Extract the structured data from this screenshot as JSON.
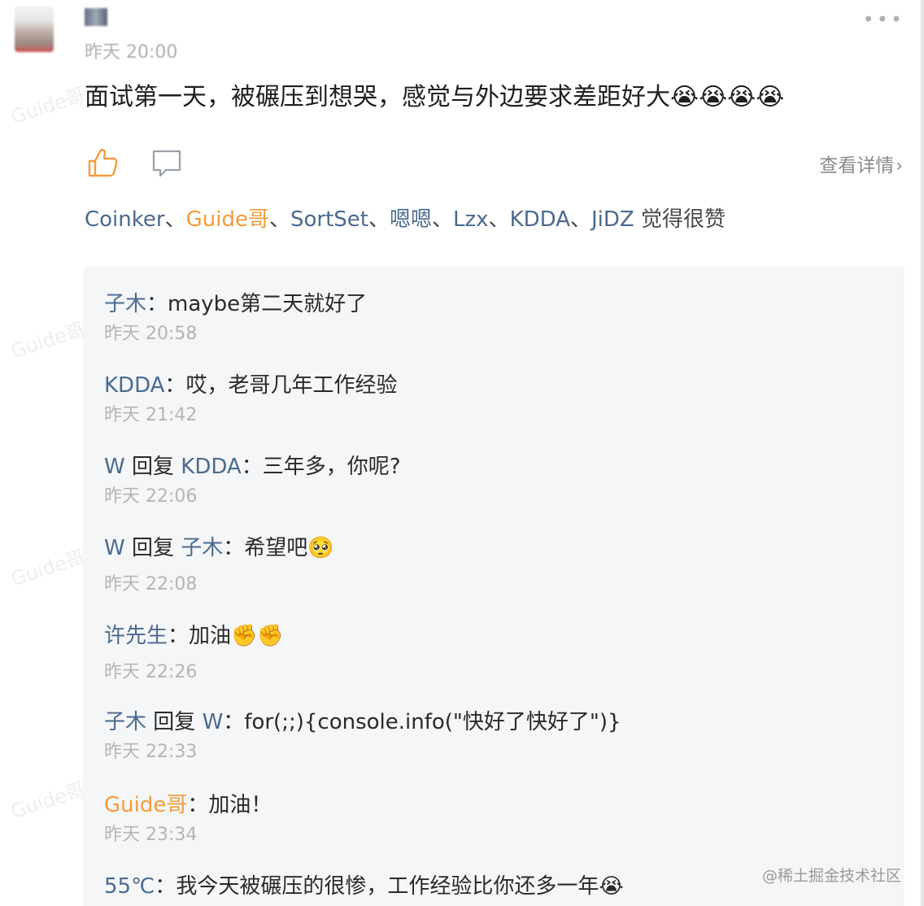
{
  "post": {
    "time": "昨天 20:00",
    "text": "面试第一天，被碾压到想哭，感觉与外边要求差距好大",
    "emojis": [
      "😭",
      "😭",
      "😭",
      "😭"
    ],
    "details_label": "查看详情"
  },
  "likers": {
    "names": [
      "Coinker",
      "Guide哥",
      "SortSet",
      "嗯嗯",
      "Lzx",
      "KDDA",
      "JiDZ"
    ],
    "separator": "、",
    "suffix": "觉得很赞"
  },
  "comments": [
    {
      "author": "子木",
      "reply_word": "",
      "reply_to": "",
      "colon": "：",
      "text": "maybe第二天就好了",
      "emoji": "",
      "time": "昨天 20:58"
    },
    {
      "author": "KDDA",
      "reply_word": "",
      "reply_to": "",
      "colon": "：",
      "text": "哎，老哥几年工作经验",
      "emoji": "",
      "time": "昨天 21:42"
    },
    {
      "author": "W",
      "reply_word": "回复",
      "reply_to": "KDDA",
      "colon": "：",
      "text": "三年多，你呢?",
      "emoji": "",
      "time": "昨天 22:06"
    },
    {
      "author": "W",
      "reply_word": "回复",
      "reply_to": "子木",
      "colon": "：",
      "text": "希望吧",
      "emoji": "🥺",
      "time": "昨天 22:08"
    },
    {
      "author": "许先生",
      "reply_word": "",
      "reply_to": "",
      "colon": "：",
      "text": "加油",
      "emoji": "✊✊",
      "time": "昨天 22:26"
    },
    {
      "author": "子木",
      "reply_word": "回复",
      "reply_to": "W",
      "colon": "：",
      "text": "for(;;){console.info(\"快好了快好了\")}",
      "emoji": "",
      "time": "昨天 22:33"
    },
    {
      "author": "Guide哥",
      "reply_word": "",
      "reply_to": "",
      "colon": "：",
      "text": "加油！",
      "emoji": "",
      "time": "昨天 23:34"
    },
    {
      "author": "55℃",
      "reply_word": "",
      "reply_to": "",
      "colon": "：",
      "text": "我今天被碾压的很惨，工作经验比你还多一年",
      "emoji": "😭",
      "time": ""
    }
  ],
  "footer": {
    "watermark": "@稀土掘金技术社区"
  },
  "colors": {
    "link_blue": "#4a6a8f",
    "highlight_orange": "#f39b3b",
    "muted_gray": "#8a8a8a",
    "comment_bg": "#f5f6f8"
  }
}
